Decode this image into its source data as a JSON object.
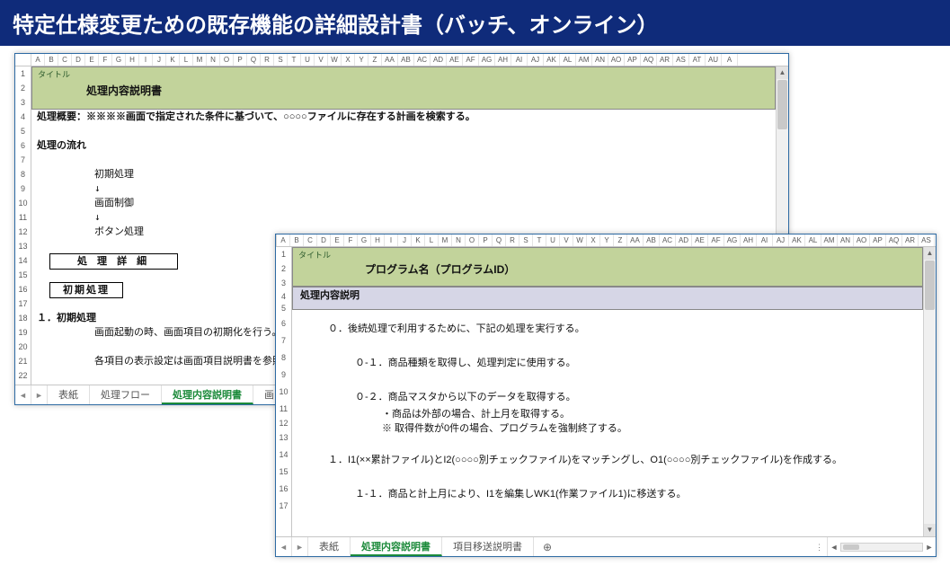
{
  "banner": {
    "title": "特定仕様変更ための既存機能の詳細設計書（バッチ、オンライン）"
  },
  "columns": [
    "A",
    "B",
    "C",
    "D",
    "E",
    "F",
    "G",
    "H",
    "I",
    "J",
    "K",
    "L",
    "M",
    "N",
    "O",
    "P",
    "Q",
    "R",
    "S",
    "T",
    "U",
    "V",
    "W",
    "X",
    "Y",
    "Z",
    "AA",
    "AB",
    "AC",
    "AD",
    "AE",
    "AF",
    "AG",
    "AH",
    "AI",
    "AJ",
    "AK",
    "AL",
    "AM",
    "AN",
    "AO",
    "AP",
    "AQ",
    "AR",
    "AS",
    "AT",
    "AU",
    "A"
  ],
  "back_sheet": {
    "head_small": "タイトル",
    "head_title": "処理内容説明書",
    "rows": {
      "r4": "処理概要：※※※※画面で指定された条件に基づいて、○○○○ファイルに存在する計画を検索する。",
      "r6": "処理の流れ",
      "r8": "初期処理",
      "r9": "↓",
      "r10": "画面制御",
      "r11": "↓",
      "r12": "ボタン処理",
      "r15": "処 理 詳 細",
      "r17": "初期処理",
      "r19": "１．初期処理",
      "r20": "画面起動の時、画面項目の初期化を行う。",
      "r22": "各項目の表示設定は画面項目説明書を参照してくだ"
    },
    "row_numbers": [
      1,
      2,
      3,
      4,
      5,
      6,
      7,
      8,
      9,
      10,
      11,
      12,
      13,
      14,
      15,
      16,
      17,
      18,
      19,
      20,
      21,
      22
    ],
    "tabs": [
      "表紙",
      "処理フロー",
      "処理内容説明書",
      "画"
    ],
    "active_tab_index": 2
  },
  "front_sheet": {
    "head_small": "タイトル",
    "head_title": "プログラム名（プログラムID）",
    "sub_title": "処理内容説明",
    "rows": {
      "r6": "０．後続処理で利用するために、下記の処理を実行する。",
      "r8": "０-１．商品種類を取得し、処理判定に使用する。",
      "r10": "０-２．商品マスタから以下のデータを取得する。",
      "r11": "・商品は外部の場合、計上月を取得する。",
      "r12": "※ 取得件数が0件の場合、プログラムを強制終了する。",
      "r14": "１．I1(××累計ファイル)とI2(○○○○別チェックファイル)をマッチングし、O1(○○○○別チェックファイル)を作成する。",
      "r16": "１-１．商品と計上月により、I1を編集しWK1(作業ファイル1)に移送する。"
    },
    "row_numbers": [
      1,
      2,
      3,
      4,
      5,
      6,
      7,
      8,
      9,
      10,
      11,
      12,
      13,
      14,
      15,
      16,
      17
    ],
    "tabs": [
      "表紙",
      "処理内容説明書",
      "項目移送説明書"
    ],
    "active_tab_index": 1
  },
  "icons": {
    "left_arrow": "◄",
    "right_arrow": "►",
    "up_arrow": "▲",
    "down_arrow": "▼",
    "plus": "⊕"
  }
}
